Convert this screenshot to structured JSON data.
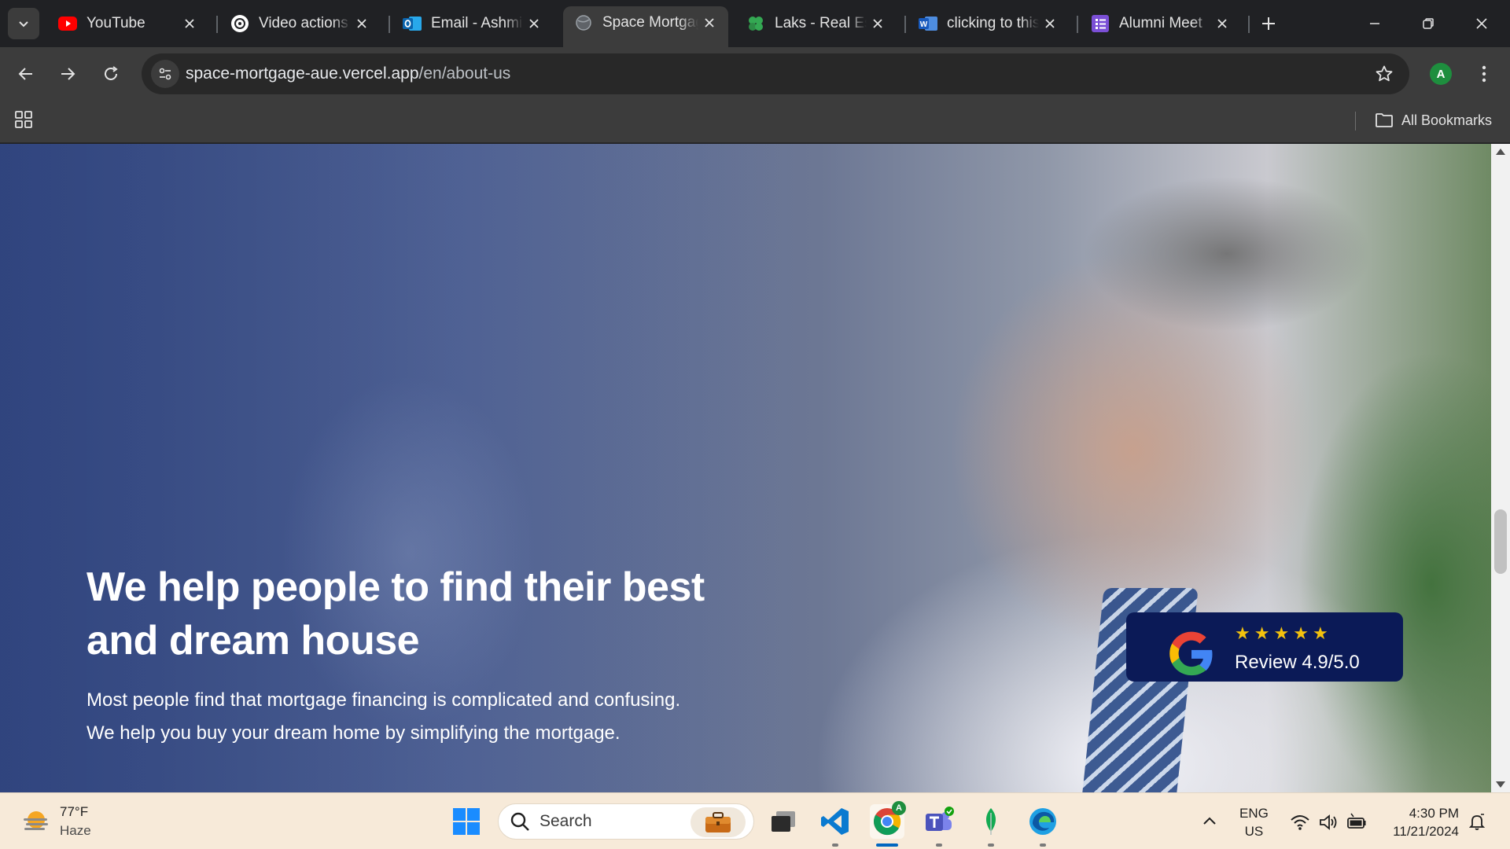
{
  "browser": {
    "tabs": [
      {
        "label": "YouTube",
        "icon": "youtube-icon",
        "active": false
      },
      {
        "label": "Video actions",
        "icon": "chatgpt-icon",
        "active": false
      },
      {
        "label": "Email - Ashmit",
        "icon": "outlook-icon",
        "active": false
      },
      {
        "label": "Space Mortgage",
        "icon": "globe-icon",
        "active": true
      },
      {
        "label": "Laks - Real Estate",
        "icon": "clover-icon",
        "active": false
      },
      {
        "label": "clicking to this",
        "icon": "word-icon",
        "active": false
      },
      {
        "label": "Alumni Meet",
        "icon": "forms-icon",
        "active": false
      }
    ],
    "url_domain": "space-mortgage-aue.vercel.app",
    "url_path": "/en/about-us",
    "profile_initial": "A",
    "all_bookmarks_label": "All Bookmarks"
  },
  "hero": {
    "title": "We help people to find their best and dream house",
    "text_line1": "Most people find that mortgage financing is complicated and confusing.",
    "text_line2": "We help you buy your dream home by simplifying the mortgage.",
    "review": {
      "stars": 5,
      "label": "Review 4.9/5.0"
    }
  },
  "taskbar": {
    "weather_temp": "77°F",
    "weather_desc": "Haze",
    "search_placeholder": "Search",
    "lang_primary": "ENG",
    "lang_secondary": "US",
    "time": "4:30 PM",
    "date": "11/21/2024"
  },
  "colors": {
    "review_card_bg": "#0b1a57",
    "star_color": "#f4c20d",
    "chrome_bg": "#3c3c3c",
    "taskbar_bg": "#f7ead9"
  }
}
